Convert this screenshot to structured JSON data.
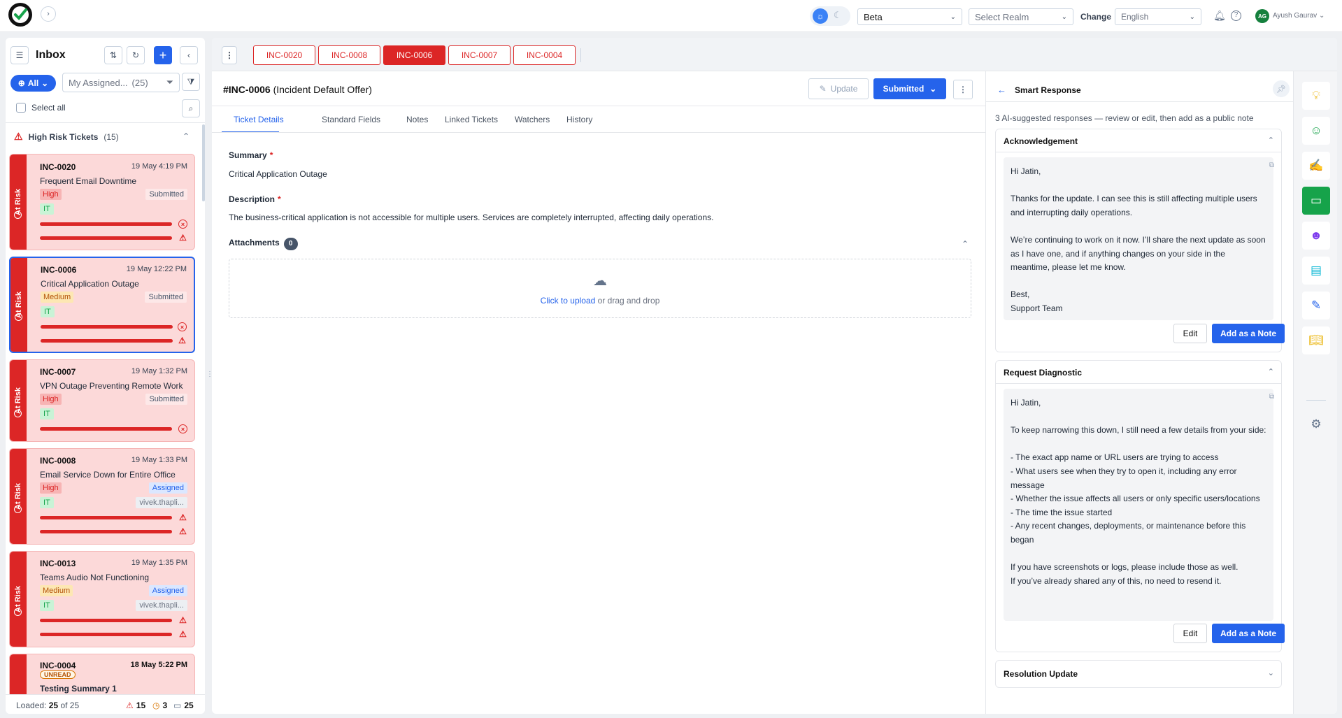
{
  "header": {
    "logo_icon": "checkmark-logo-icon",
    "version_select": "Beta",
    "realm_placeholder": "Select Realm",
    "change_label": "Change",
    "language_select": "English",
    "user_initials": "AG",
    "user_name": "Ayush Gaurav"
  },
  "inbox": {
    "title": "Inbox",
    "filter_all": "All",
    "assigned_filter": "My Assigned...",
    "assigned_count": "(25)",
    "select_all": "Select all",
    "group_title": "High Risk Tickets",
    "group_count": "(15)",
    "risk_label": "At Risk",
    "cards": [
      {
        "id": "INC-0020",
        "date": "19 May 4:19 PM",
        "title": "Frequent Email Downtime",
        "priority": "High",
        "status": "Submitted",
        "category": "IT"
      },
      {
        "id": "INC-0006",
        "date": "19 May 12:22 PM",
        "title": "Critical Application Outage",
        "priority": "Medium",
        "status": "Submitted",
        "category": "IT"
      },
      {
        "id": "INC-0007",
        "date": "19 May 1:32 PM",
        "title": "VPN Outage Preventing Remote Work",
        "priority": "High",
        "status": "Submitted",
        "category": "IT"
      },
      {
        "id": "INC-0008",
        "date": "19 May 1:33 PM",
        "title": "Email Service Down for Entire Office",
        "priority": "High",
        "status": "Assigned",
        "category": "IT",
        "assignee": "vivek.thapli..."
      },
      {
        "id": "INC-0013",
        "date": "19 May 1:35 PM",
        "title": "Teams Audio Not Functioning",
        "priority": "Medium",
        "status": "Assigned",
        "category": "IT",
        "assignee": "vivek.thapli..."
      },
      {
        "id": "INC-0004",
        "date": "18 May 5:22 PM",
        "title": "Testing Summary 1",
        "badge": "UNREAD"
      }
    ],
    "footer": {
      "loaded_label": "Loaded:",
      "loaded": "25",
      "of_label": "of",
      "total": "25",
      "risk_count": "15",
      "warn_count": "3",
      "folder_count": "25"
    }
  },
  "open_tabs": [
    "INC-0020",
    "INC-0008",
    "INC-0006",
    "INC-0007",
    "INC-0004"
  ],
  "active_tab": "INC-0006",
  "ticket": {
    "id": "#INC-0006",
    "offer": "(Incident Default Offer)",
    "update_label": "Update",
    "status_label": "Submitted",
    "tabs": [
      "Ticket Details",
      "Standard Fields",
      "Notes",
      "Linked Tickets",
      "Watchers",
      "History"
    ],
    "summary_label": "Summary",
    "summary": "Critical Application Outage",
    "description_label": "Description",
    "description": "The business-critical application is not accessible for multiple users. Services are completely interrupted, affecting daily operations.",
    "attachments_label": "Attachments",
    "attachments_count": "0",
    "upload_link": "Click to upload",
    "upload_rest": "or drag and drop"
  },
  "smart_response": {
    "title": "Smart Response",
    "subtitle": "3 AI-suggested responses — review or edit, then add as a public note",
    "edit_label": "Edit",
    "add_note_label": "Add as a Note",
    "sections": [
      {
        "title": "Acknowledgement",
        "body": "Hi Jatin,\n\nThanks for the update. I can see this is still affecting multiple users and interrupting daily operations.\n\nWe’re continuing to work on it now. I’ll share the next update as soon as I have one, and if anything changes on your side in the meantime, please let me know.\n\nBest,\nSupport Team"
      },
      {
        "title": "Request Diagnostic",
        "body": "Hi Jatin,\n\nTo keep narrowing this down, I still need a few details from your side:\n\n- The exact app name or URL users are trying to access\n- What users see when they try to open it, including any error message\n- Whether the issue affects all users or only specific users/locations\n- The time the issue started\n- Any recent changes, deployments, or maintenance before this began\n\nIf you have screenshots or logs, please include those as well.\nIf you’ve already shared any of this, no need to resend it."
      },
      {
        "title": "Resolution Update"
      }
    ]
  },
  "rail_icons": [
    "lightbulb-icon",
    "smiley-icon",
    "feedback-icon",
    "chat-icon",
    "robot-icon",
    "ticket-icon",
    "edit-box-icon",
    "book-icon",
    "settings-icon"
  ]
}
